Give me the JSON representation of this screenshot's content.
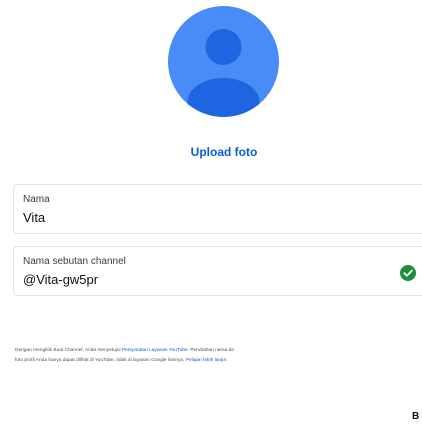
{
  "avatar": {
    "icon": "person-avatar-icon",
    "background": "#4a8cf7",
    "figure": "#1f64e0"
  },
  "upload_photo_label": "Upload foto",
  "fields": {
    "name": {
      "label": "Nama",
      "value": "Vita"
    },
    "handle": {
      "label": "Nama sebutan channel",
      "value": "@Vita-gw5pr",
      "status_icon": "check-circle-icon",
      "status_color": "#1e8e3e"
    }
  },
  "terms": {
    "line1_text": "Dengan mengklik Buat Channel, Anda menyetujui ",
    "tos_link": "Persyaratan Layanan YouTube",
    "line1_rest": ". Perubahan nama da",
    "line2_text": "foto profil Anda hanya dapat dilihat di YouTube, tidak di layanan Google lainnya. ",
    "learn_more_link": "Pelajari lebih lanjut"
  },
  "create_button_label": "B",
  "colors": {
    "accent": "#065fd4"
  }
}
